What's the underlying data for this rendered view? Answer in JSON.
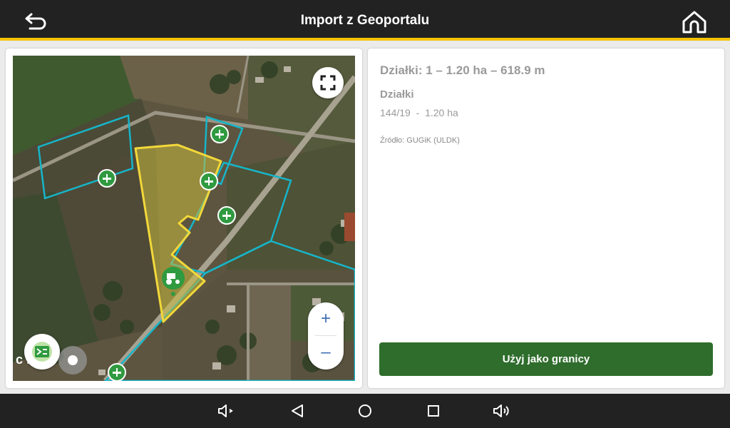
{
  "header": {
    "title": "Import z Geoportalu",
    "back_icon": "back-arrow-icon",
    "home_icon": "home-icon",
    "accent_color": "#f5c400"
  },
  "map": {
    "fullscreen_icon": "fullscreen-icon",
    "zoom_in_label": "+",
    "zoom_out_label": "–",
    "layers_icon": "map-layers-icon",
    "vehicle_icon": "tractor-icon",
    "watermark": "c      r",
    "selected_parcel_color": "#f2d83a",
    "other_parcel_color": "#16b5c9",
    "marker_color": "#2f9a3f"
  },
  "info": {
    "heading": "Działki: 1 – 1.20 ha – 618.9 m",
    "section_label": "Działki",
    "parcels": [
      {
        "id": "144/19",
        "separator": "  -  ",
        "area": "1.20 ha"
      }
    ],
    "source": "Źródło: GUGiK (ULDK)"
  },
  "actions": {
    "use_as_boundary": "Użyj jako granicy",
    "button_color": "#2f6d2c"
  },
  "system_nav": {
    "icons": [
      "volume-down-icon",
      "back-triangle-icon",
      "home-circle-icon",
      "recents-square-icon",
      "volume-up-icon"
    ]
  }
}
